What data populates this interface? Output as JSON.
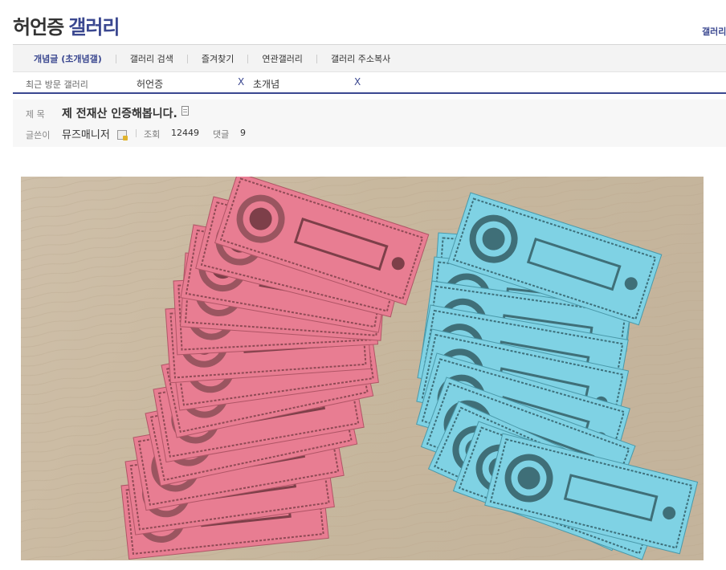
{
  "gallery_title": {
    "part1": "허언증",
    "part2": "갤러리"
  },
  "top_right_link": "갤러리",
  "tabs": [
    {
      "label": "개념글 (초개념갤)",
      "active": true
    },
    {
      "label": "갤러리 검색",
      "active": false
    },
    {
      "label": "즐겨찾기",
      "active": false
    },
    {
      "label": "연관갤러리",
      "active": false
    },
    {
      "label": "갤러리 주소복사",
      "active": false
    }
  ],
  "recent": {
    "label": "최근 방문 갤러리",
    "items": [
      {
        "name": "허언증",
        "close": "X"
      },
      {
        "name": "초개념",
        "close": "X"
      }
    ]
  },
  "post": {
    "subject_label": "제 목",
    "subject": "제 전재산 인증해봅니다.",
    "writer_label": "글쓴이",
    "writer": "뮤즈매니저",
    "views_label": "조회",
    "views": "12449",
    "comments_label": "댓글",
    "comments": "9"
  },
  "colors": {
    "accent": "#3b4890",
    "pink_note": "#e8798f",
    "blue_note": "#7fd1e3",
    "wood": "#c9b89e"
  },
  "photo": {
    "alt_kind": "photo of pink and blue play-money notes fanned on a wooden floor"
  }
}
